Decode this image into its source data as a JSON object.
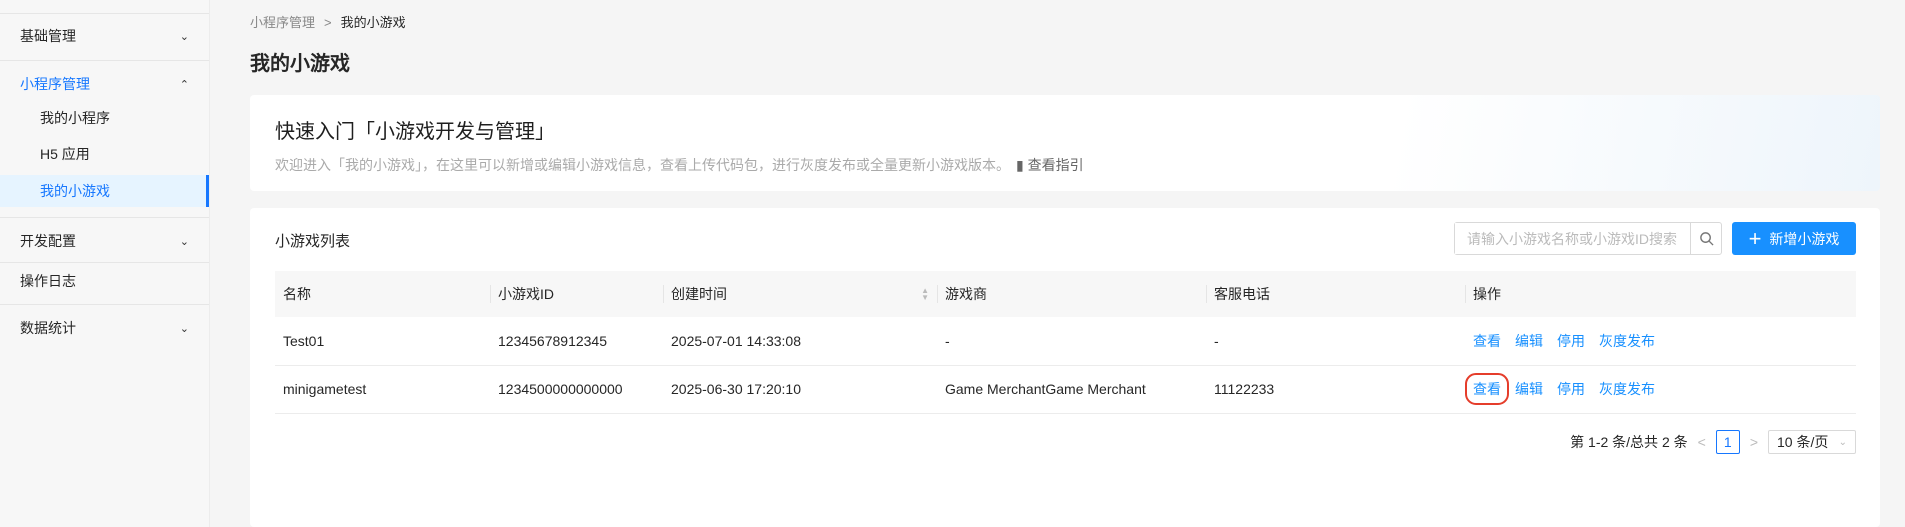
{
  "sidebar": {
    "items": [
      {
        "label": "基础管理"
      },
      {
        "label": "小程序管理",
        "children": [
          {
            "label": "我的小程序"
          },
          {
            "label": "H5 应用"
          },
          {
            "label": "我的小游戏"
          }
        ]
      },
      {
        "label": "开发配置"
      },
      {
        "label": "操作日志"
      },
      {
        "label": "数据统计"
      }
    ]
  },
  "breadcrumb": {
    "parent": "小程序管理",
    "separator": ">",
    "current": "我的小游戏"
  },
  "page_title": "我的小游戏",
  "intro": {
    "title": "快速入门「小游戏开发与管理」",
    "description": "欢迎进入「我的小游戏」，在这里可以新增或编辑小游戏信息，查看上传代码包，进行灰度发布或全量更新小游戏版本。",
    "guide_link": "查看指引"
  },
  "list": {
    "title": "小游戏列表",
    "search_placeholder": "请输入小游戏名称或小游戏ID搜索",
    "add_button": "新增小游戏",
    "columns": [
      "名称",
      "小游戏ID",
      "创建时间",
      "游戏商",
      "客服电话",
      "操作"
    ],
    "rows": [
      {
        "name": "Test01",
        "id": "12345678912345",
        "created": "2025-07-01 14:33:08",
        "merchant": "-",
        "phone": "-"
      },
      {
        "name": "minigametest",
        "id": "1234500000000000",
        "created": "2025-06-30 17:20:10",
        "merchant": "Game MerchantGame Merchant",
        "phone": "11122233"
      }
    ],
    "actions": [
      "查看",
      "编辑",
      "停用",
      "灰度发布"
    ]
  },
  "pagination": {
    "summary": "第 1-2 条/总共 2 条",
    "current_page": "1",
    "page_size": "10 条/页"
  },
  "colors": {
    "accent": "#1890ff",
    "highlight": "#e53d2b"
  }
}
